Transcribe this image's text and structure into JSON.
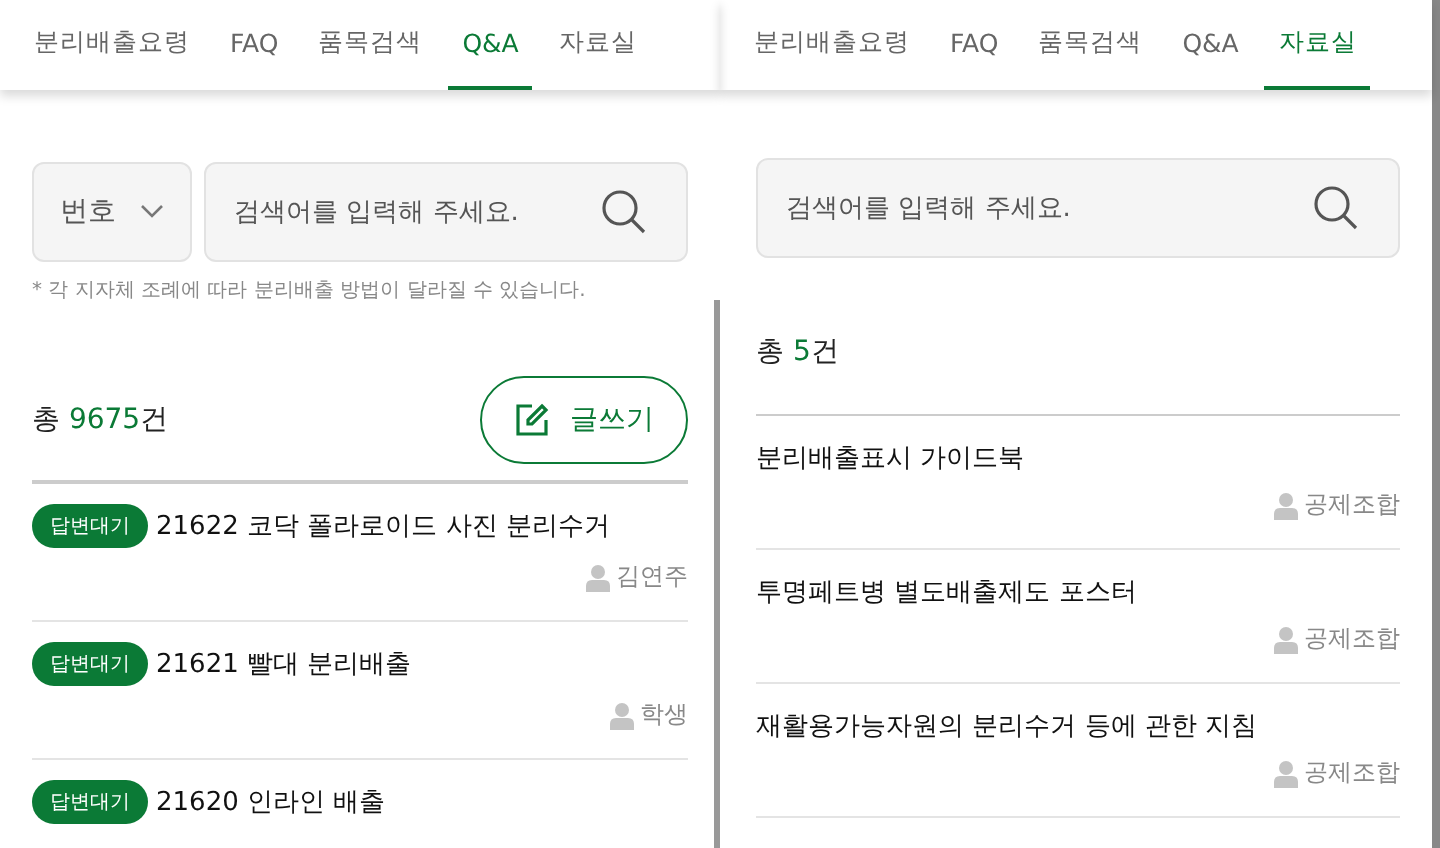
{
  "panels": [
    {
      "kind": "qna",
      "tabs": [
        {
          "label": "분리배출요령",
          "selected": false
        },
        {
          "label": "FAQ",
          "selected": false
        },
        {
          "label": "품목검색",
          "selected": false
        },
        {
          "label": "Q&A",
          "selected": true
        },
        {
          "label": "자료실",
          "selected": false
        }
      ],
      "filter": {
        "value": "번호"
      },
      "search": {
        "placeholder": "검색어를 입력해 주세요."
      },
      "note": "* 각 지자체 조례에 따라 분리배출 방법이 달라질 수 있습니다.",
      "total": {
        "prefix": "총 ",
        "count": "9675",
        "suffix": "건"
      },
      "write_button": "글쓰기",
      "items": [
        {
          "status": "답변대기",
          "title": "21622 코닥 폴라로이드 사진 분리수거",
          "author": "김연주"
        },
        {
          "status": "답변대기",
          "title": "21621 빨대 분리배출",
          "author": "학생"
        },
        {
          "status": "답변대기",
          "title": "21620 인라인 배출"
        }
      ]
    },
    {
      "kind": "library",
      "tabs": [
        {
          "label": "분리배출요령",
          "selected": false
        },
        {
          "label": "FAQ",
          "selected": false
        },
        {
          "label": "품목검색",
          "selected": false
        },
        {
          "label": "Q&A",
          "selected": false
        },
        {
          "label": "자료실",
          "selected": true
        }
      ],
      "search": {
        "placeholder": "검색어를 입력해 주세요."
      },
      "total": {
        "prefix": "총 ",
        "count": "5",
        "suffix": "건"
      },
      "items": [
        {
          "title": "분리배출표시 가이드북",
          "author": "공제조합"
        },
        {
          "title": "투명페트병 별도배출제도 포스터",
          "author": "공제조합"
        },
        {
          "title": "재활용가능자원의 분리수거 등에 관한 지침",
          "author": "공제조합"
        }
      ]
    }
  ]
}
